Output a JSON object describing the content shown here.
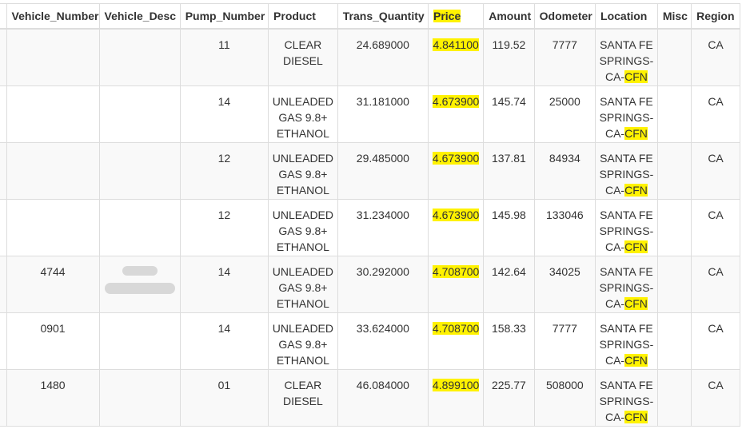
{
  "columns": [
    "Vehicle_Number",
    "Vehicle_Desc",
    "Pump_Number",
    "Product",
    "Trans_Quantity",
    "Price",
    "Amount",
    "Odometer",
    "Location",
    "Misc",
    "Region"
  ],
  "highlight_color": "#fff200",
  "rows": [
    {
      "vehicle_number": "",
      "vehicle_desc": "",
      "pump_number": "11",
      "product": "CLEAR DIESEL",
      "trans_quantity": "24.689000",
      "price": "4.841100",
      "amount": "119.52",
      "odometer": "7777",
      "location_prefix": "SANTA FE SPRINGS-CA-",
      "location_hl": "CFN",
      "misc": "",
      "region": "CA",
      "desc_redacted": false
    },
    {
      "vehicle_number": "",
      "vehicle_desc": "",
      "pump_number": "14",
      "product": "UNLEADED GAS 9.8+ ETHANOL",
      "trans_quantity": "31.181000",
      "price": "4.673900",
      "amount": "145.74",
      "odometer": "25000",
      "location_prefix": "SANTA FE SPRINGS-CA-",
      "location_hl": "CFN",
      "misc": "",
      "region": "CA",
      "desc_redacted": false
    },
    {
      "vehicle_number": "",
      "vehicle_desc": "",
      "pump_number": "12",
      "product": "UNLEADED GAS 9.8+ ETHANOL",
      "trans_quantity": "29.485000",
      "price": "4.673900",
      "amount": "137.81",
      "odometer": "84934",
      "location_prefix": "SANTA FE SPRINGS-CA-",
      "location_hl": "CFN",
      "misc": "",
      "region": "CA",
      "desc_redacted": false
    },
    {
      "vehicle_number": "",
      "vehicle_desc": "",
      "pump_number": "12",
      "product": "UNLEADED GAS 9.8+ ETHANOL",
      "trans_quantity": "31.234000",
      "price": "4.673900",
      "amount": "145.98",
      "odometer": "133046",
      "location_prefix": "SANTA FE SPRINGS-CA-",
      "location_hl": "CFN",
      "misc": "",
      "region": "CA",
      "desc_redacted": false
    },
    {
      "vehicle_number": "4744",
      "vehicle_desc": "",
      "pump_number": "14",
      "product": "UNLEADED GAS 9.8+ ETHANOL",
      "trans_quantity": "30.292000",
      "price": "4.708700",
      "amount": "142.64",
      "odometer": "34025",
      "location_prefix": "SANTA FE SPRINGS-CA-",
      "location_hl": "CFN",
      "misc": "",
      "region": "CA",
      "desc_redacted": true
    },
    {
      "vehicle_number": "0901",
      "vehicle_desc": "",
      "pump_number": "14",
      "product": "UNLEADED GAS 9.8+ ETHANOL",
      "trans_quantity": "33.624000",
      "price": "4.708700",
      "amount": "158.33",
      "odometer": "7777",
      "location_prefix": "SANTA FE SPRINGS-CA-",
      "location_hl": "CFN",
      "misc": "",
      "region": "CA",
      "desc_redacted": false
    },
    {
      "vehicle_number": "1480",
      "vehicle_desc": "",
      "pump_number": "01",
      "product": "CLEAR DIESEL",
      "trans_quantity": "46.084000",
      "price": "4.899100",
      "amount": "225.77",
      "odometer": "508000",
      "location_prefix": "SANTA FE SPRINGS-CA-",
      "location_hl": "CFN",
      "misc": "",
      "region": "CA",
      "desc_redacted": false
    }
  ]
}
